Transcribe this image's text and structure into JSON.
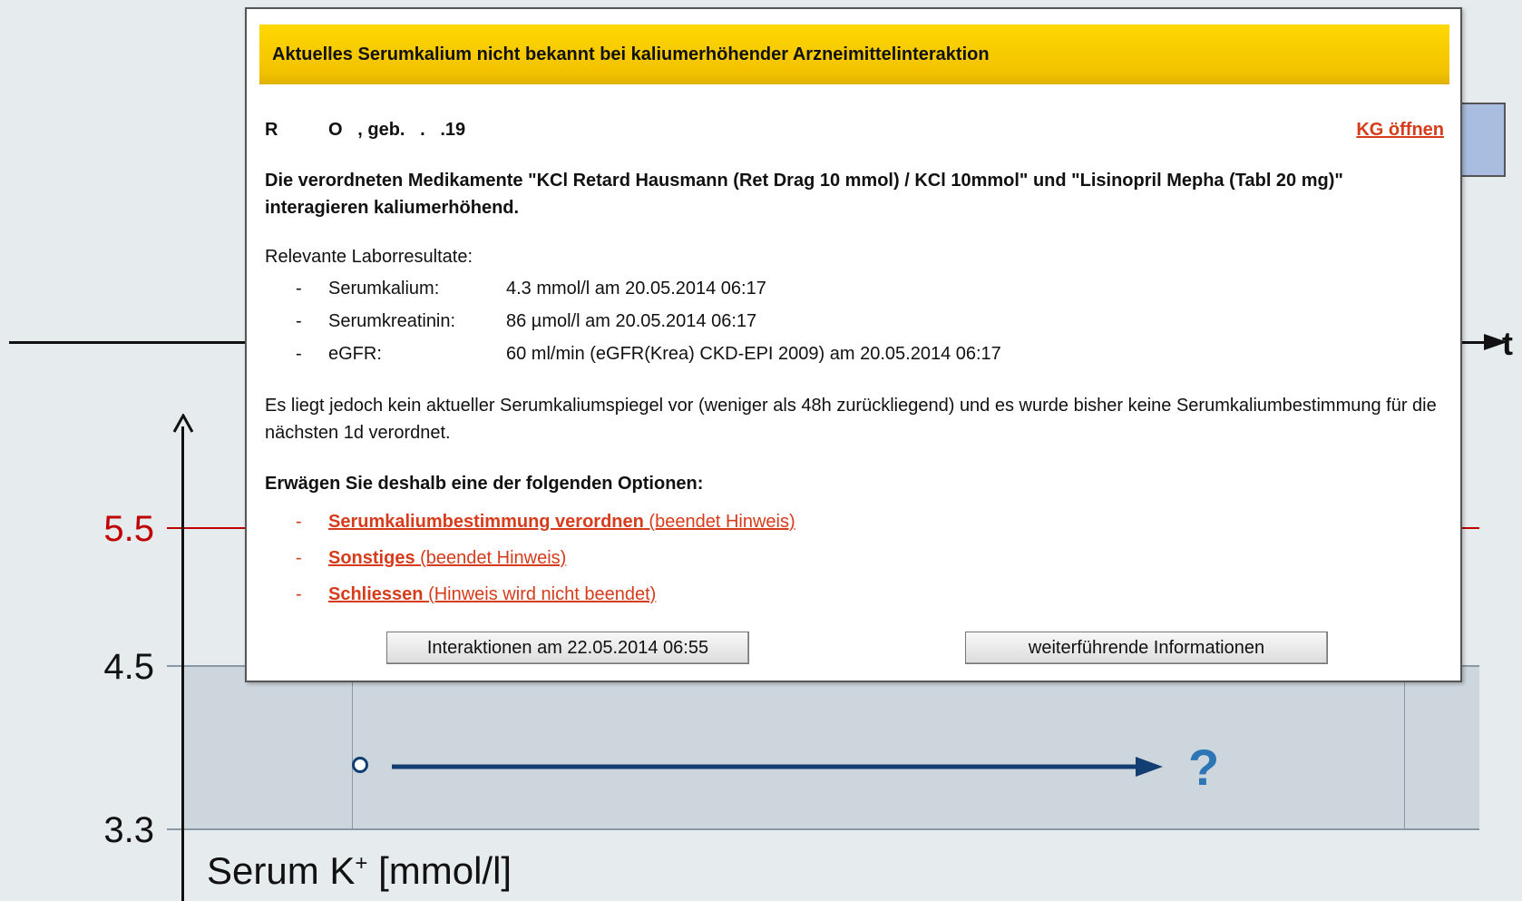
{
  "chart": {
    "y_ticks": [
      {
        "label": "5.5",
        "color": "#c00000"
      },
      {
        "label": "4.5",
        "color": "#111111"
      },
      {
        "label": "3.3",
        "color": "#111111"
      }
    ],
    "x_axis_label": "t",
    "y_axis_title": "Serum K",
    "y_axis_title_sup": "+",
    "y_axis_title_unit": " [mmol/l]",
    "question_mark": "?",
    "colors": {
      "band": "#cdd6dd",
      "threshold_line": "#c00000",
      "arrow": "#2e75b6"
    }
  },
  "dialog": {
    "title": "Aktuelles Serumkalium nicht bekannt bei kaliumerhöhender Arzneimittelinteraktion",
    "patient": "R          O   , geb.   .   .19",
    "kg_link": "KG öffnen",
    "medication_text": "Die verordneten Medikamente \"KCl Retard Hausmann (Ret Drag 10 mmol) / KCl 10mmol\" und \"Lisinopril Mepha (Tabl 20 mg)\" interagieren kaliumerhöhend.",
    "lab_title": "Relevante Laborresultate:",
    "lab_results": [
      {
        "dash": "-",
        "name": "Serumkalium:",
        "value": "4.3 mmol/l am 20.05.2014 06:17"
      },
      {
        "dash": "-",
        "name": "Serumkreatinin:",
        "value": "86 µmol/l am 20.05.2014 06:17"
      },
      {
        "dash": "-",
        "name": "eGFR:",
        "value": "60 ml/min (eGFR(Krea) CKD-EPI 2009) am 20.05.2014 06:17"
      }
    ],
    "no_potassium_text": "Es liegt jedoch kein aktueller Serumkaliumspiegel vor (weniger als 48h zurückliegend) und es wurde bisher keine Serumkaliumbestimmung für die nächsten 1d verordnet.",
    "options_title": "Erwägen Sie deshalb eine der folgenden Optionen:",
    "options": [
      {
        "dash": "-",
        "label": "Serumkaliumbestimmung verordnen",
        "note": " (beendet Hinweis)"
      },
      {
        "dash": "-",
        "label": "Sonstiges",
        "note": " (beendet Hinweis)"
      },
      {
        "dash": "-",
        "label": "Schliessen",
        "note": " (Hinweis wird nicht beendet)"
      }
    ],
    "buttons": {
      "interactions": "Interaktionen am 22.05.2014 06:55",
      "more_info": "weiterführende Informationen"
    },
    "colors": {
      "header": "#ffd800",
      "link": "#d63c1c"
    }
  }
}
